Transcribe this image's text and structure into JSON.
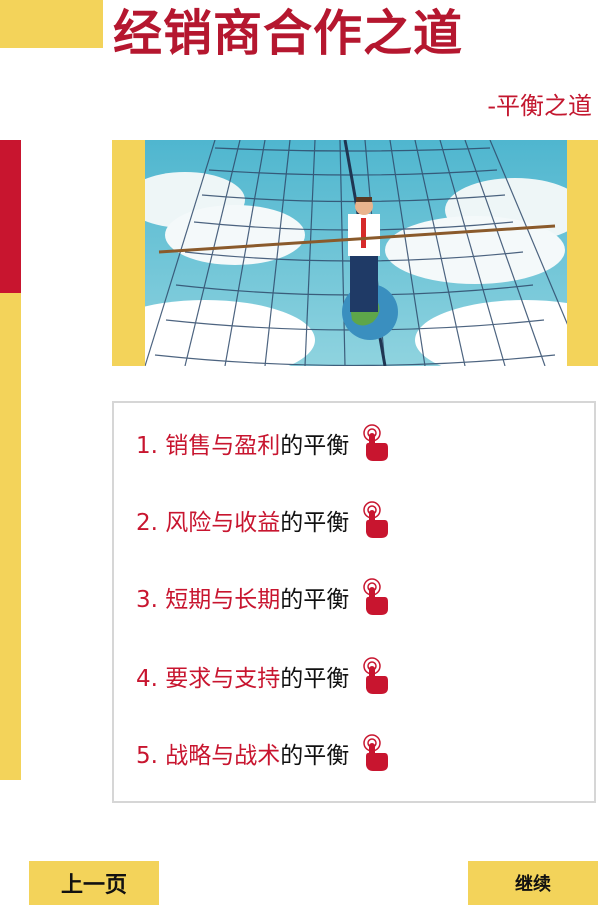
{
  "header": {
    "title": "经销商合作之道",
    "subtitle": "-平衡之道"
  },
  "menu": {
    "items": [
      {
        "label": "1. 销售与盈利",
        "suffix": "的平衡",
        "icon": "pointing-hand-icon"
      },
      {
        "label": "2. 风险与收益",
        "suffix": "的平衡",
        "icon": "pointing-hand-icon"
      },
      {
        "label": "3. 短期与长期",
        "suffix": "的平衡",
        "icon": "pointing-hand-icon"
      },
      {
        "label": "4. 要求与支持",
        "suffix": "的平衡",
        "icon": "pointing-hand-icon"
      },
      {
        "label": "5. 战略与战术",
        "suffix": "的平衡",
        "icon": "pointing-hand-icon"
      }
    ]
  },
  "nav": {
    "prev_label": "上一页",
    "next_label": "继续"
  },
  "colors": {
    "accent_red": "#c8152f",
    "accent_yellow": "#f3d35a",
    "border_gray": "#d6d6d6"
  }
}
